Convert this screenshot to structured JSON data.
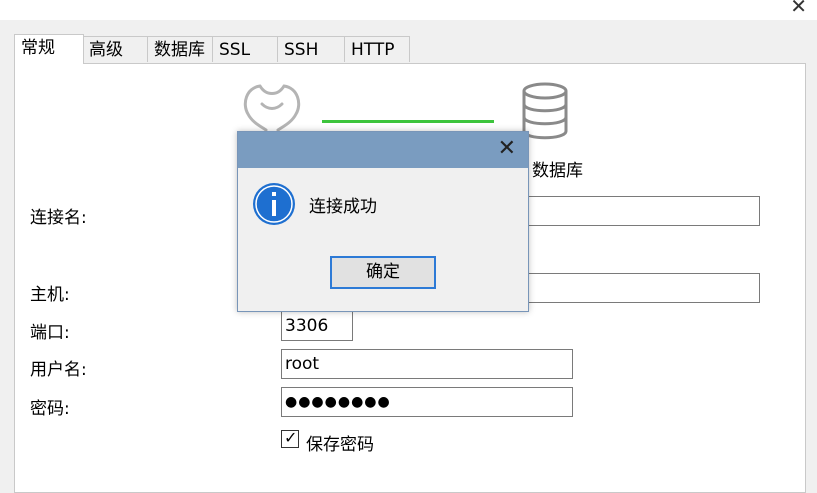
{
  "window": {
    "close_glyph": "✕"
  },
  "tabs": [
    {
      "label": "常规",
      "active": true
    },
    {
      "label": "高级"
    },
    {
      "label": "数据库"
    },
    {
      "label": "SSL"
    },
    {
      "label": "SSH"
    },
    {
      "label": "HTTP"
    }
  ],
  "header": {
    "left_icon": "navicat-logo-icon",
    "right_icon": "database-icon",
    "right_caption": "数据库",
    "connector_color": "#3cc43c"
  },
  "form": {
    "connection_name_label": "连接名:",
    "connection_name_value": "",
    "host_label": "主机:",
    "host_value": "",
    "port_label": "端口:",
    "port_value": "3306",
    "username_label": "用户名:",
    "username_value": "root",
    "password_label": "密码:",
    "password_value": "●●●●●●●●",
    "save_password_label": "保存密码",
    "save_password_checked": true
  },
  "dialog": {
    "message": "连接成功",
    "ok_label": "确定",
    "close_glyph": "✕",
    "icon": "info-icon",
    "title_color": "#7a9cc0",
    "accent": "#1e6fd0"
  }
}
